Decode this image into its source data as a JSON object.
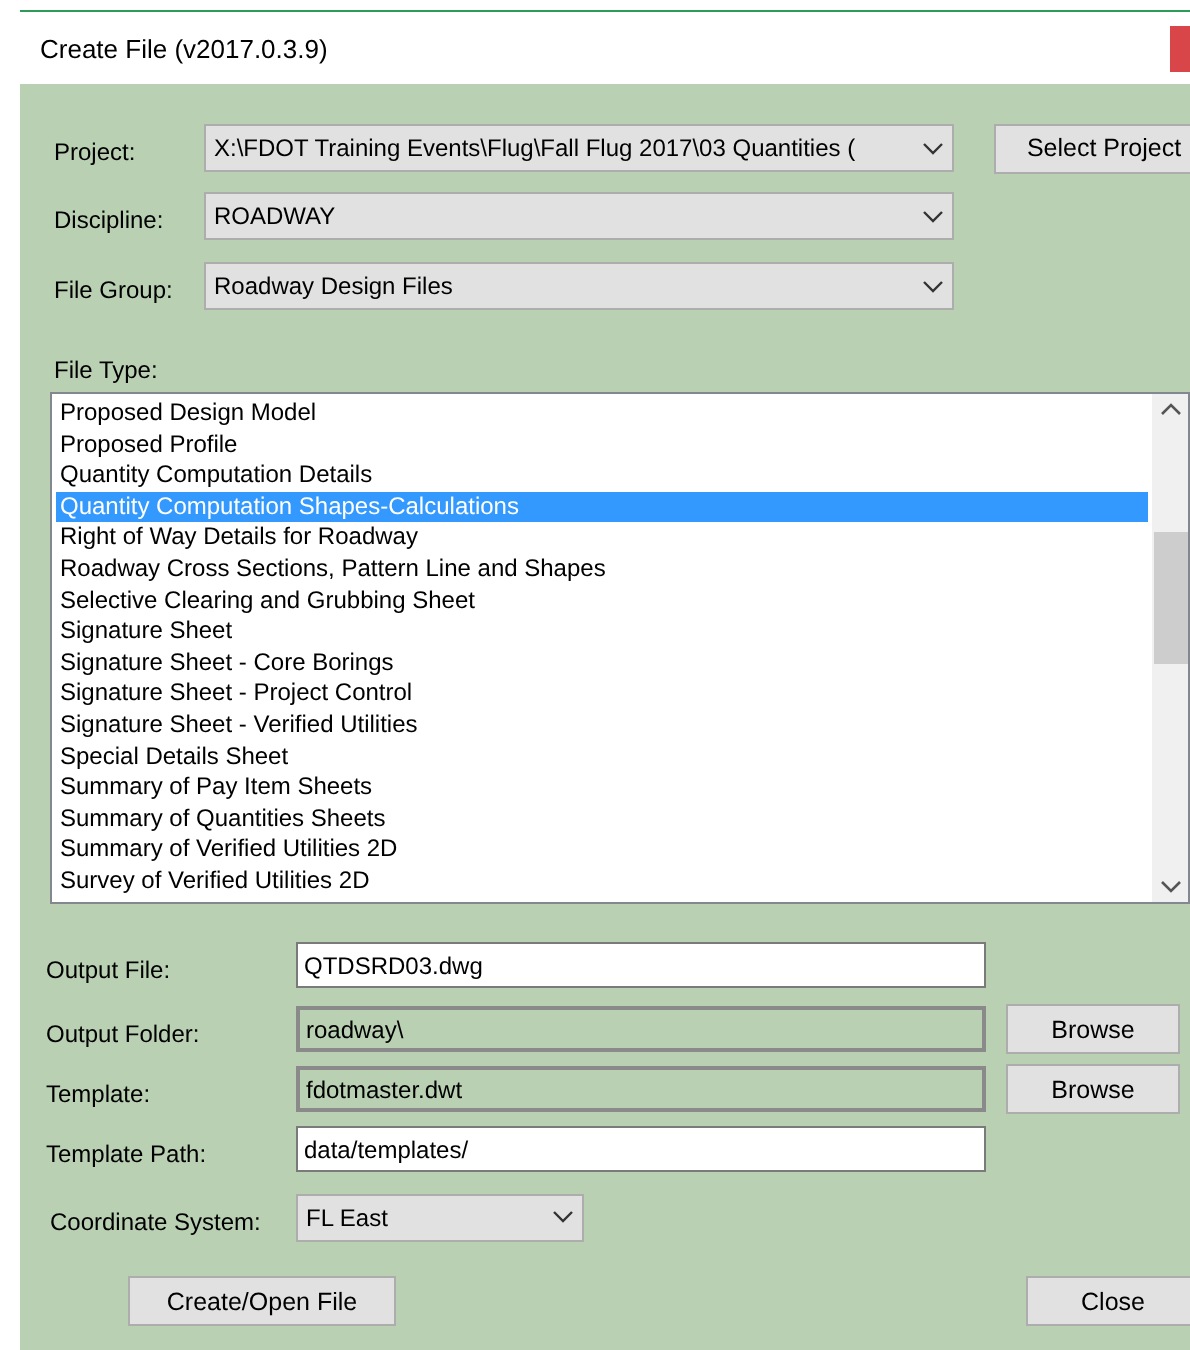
{
  "window": {
    "title": "Create File (v2017.0.3.9)"
  },
  "combos": [
    {
      "label": "Project:",
      "value": "X:\\FDOT Training Events\\Flug\\Fall Flug 2017\\03 Quantities (",
      "button": "Select Project"
    },
    {
      "label": "Discipline:",
      "value": "ROADWAY"
    },
    {
      "label": "File Group:",
      "value": "Roadway Design Files"
    }
  ],
  "file_type": {
    "label": "File Type:",
    "items": [
      {
        "text": "Proposed Design Model",
        "selected": false
      },
      {
        "text": "Proposed Profile",
        "selected": false
      },
      {
        "text": "Quantity Computation Details",
        "selected": false
      },
      {
        "text": "Quantity Computation Shapes-Calculations",
        "selected": true
      },
      {
        "text": "Right of Way Details for Roadway",
        "selected": false
      },
      {
        "text": "Roadway Cross Sections, Pattern Line and Shapes",
        "selected": false
      },
      {
        "text": "Selective Clearing and Grubbing Sheet",
        "selected": false
      },
      {
        "text": "Signature Sheet",
        "selected": false
      },
      {
        "text": "Signature Sheet - Core Borings",
        "selected": false
      },
      {
        "text": "Signature Sheet - Project Control",
        "selected": false
      },
      {
        "text": "Signature Sheet - Verified Utilities",
        "selected": false
      },
      {
        "text": "Special Details Sheet",
        "selected": false
      },
      {
        "text": "Summary of Pay Item Sheets",
        "selected": false
      },
      {
        "text": "Summary of Quantities Sheets",
        "selected": false
      },
      {
        "text": "Summary of Verified Utilities 2D",
        "selected": false
      },
      {
        "text": "Survey of Verified Utilities 2D",
        "selected": false
      }
    ]
  },
  "fields": [
    {
      "label": "Output File:",
      "value": "QTDSRD03.dwg",
      "disabled": false
    },
    {
      "label": "Output Folder:",
      "value": "roadway\\",
      "disabled": true,
      "button": "Browse"
    },
    {
      "label": "Template:",
      "value": "fdotmaster.dwt",
      "disabled": true,
      "button": "Browse"
    },
    {
      "label": "Template Path:",
      "value": "data/templates/",
      "disabled": false
    }
  ],
  "coordinate_system": {
    "label": "Coordinate System:",
    "value": "FL East"
  },
  "buttons": [
    "Create/Open File",
    "Close"
  ]
}
